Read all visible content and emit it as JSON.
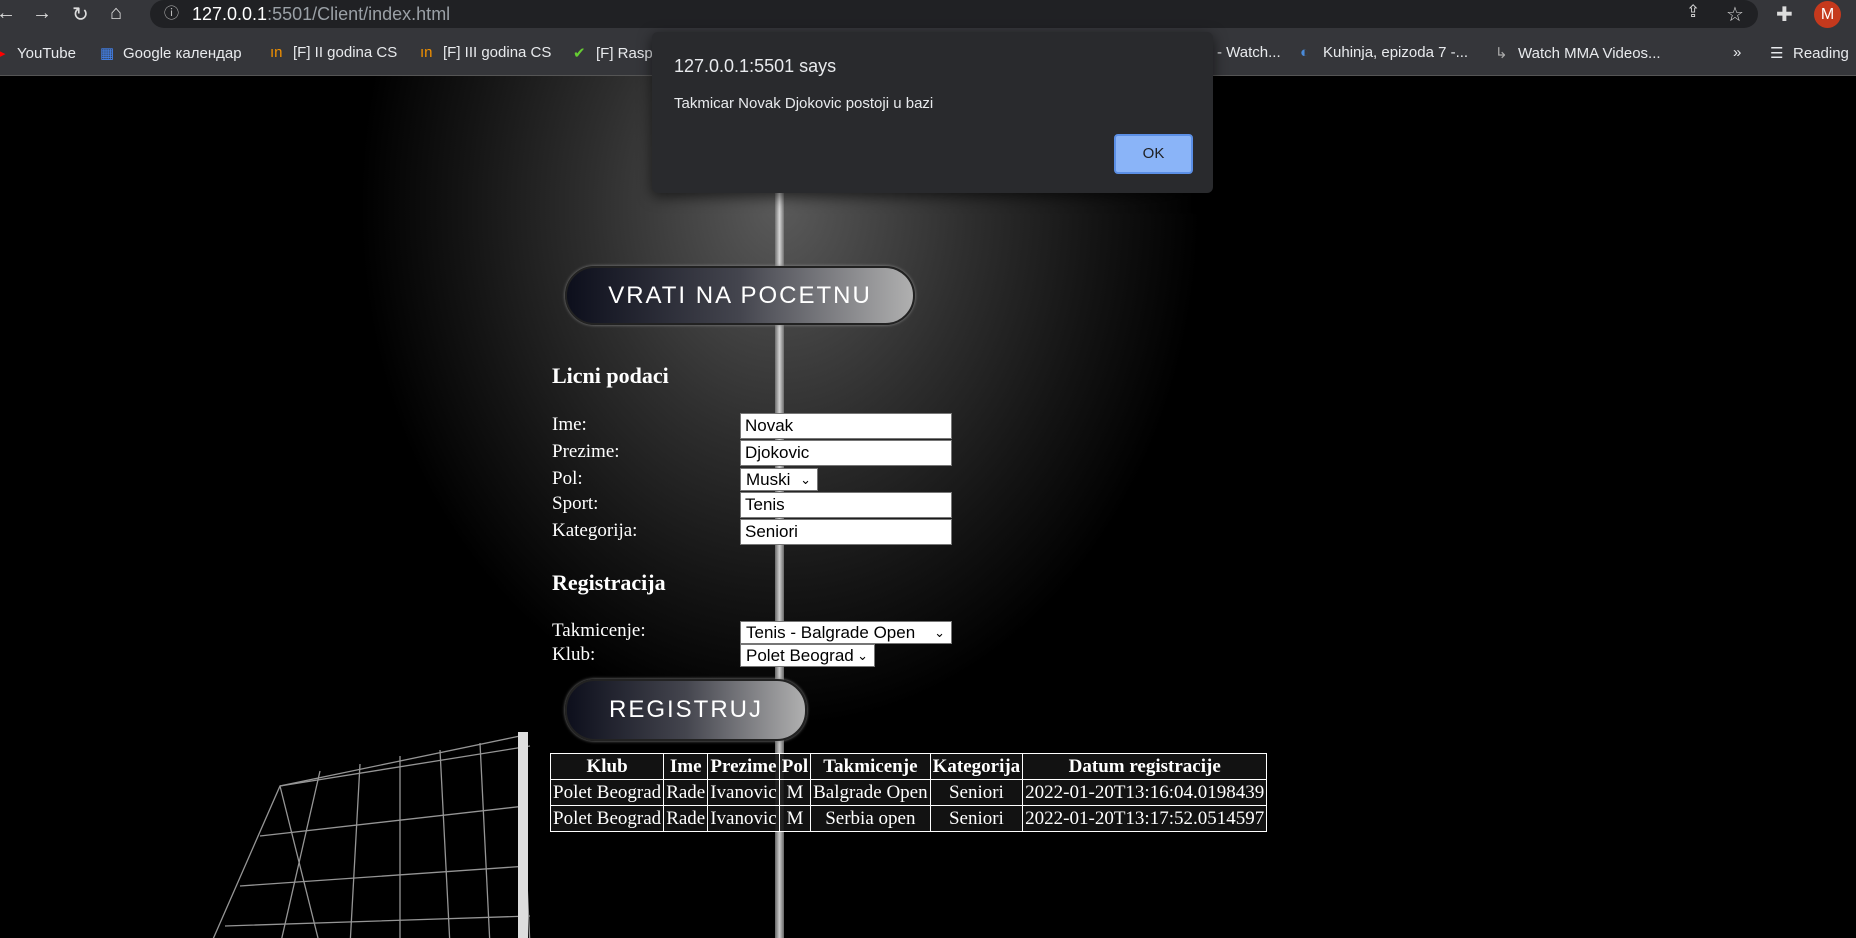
{
  "browser": {
    "url_host": "127.0.0.1",
    "url_rest": ":5501/Client/index.html",
    "avatar_letter": "M",
    "bookmarks": [
      "YouTube",
      "Google календар",
      "[F] II godina CS",
      "[F] III godina CS",
      "[F] Rasp",
      "- Watch...",
      "Kuhinja, epizoda 7 -...",
      "Watch MMA Videos...",
      "»",
      "Reading"
    ]
  },
  "dialog": {
    "title": "127.0.0.1:5501 says",
    "message": "Takmicar Novak Djokovic postoji u bazi",
    "ok_label": "OK"
  },
  "back_button": "VRATI NA POCETNU",
  "personal": {
    "heading": "Licni podaci",
    "ime_label": "Ime:",
    "ime_value": "Novak",
    "prezime_label": "Prezime:",
    "prezime_value": "Djokovic",
    "pol_label": "Pol:",
    "pol_value": "Muski",
    "sport_label": "Sport:",
    "sport_value": "Tenis",
    "kategorija_label": "Kategorija:",
    "kategorija_value": "Seniori"
  },
  "registration": {
    "heading": "Registracija",
    "takmicenje_label": "Takmicenje:",
    "takmicenje_value": "Tenis - Balgrade Open",
    "klub_label": "Klub:",
    "klub_value": "Polet Beograd",
    "submit": "REGISTRUJ"
  },
  "table": {
    "headers": [
      "Klub",
      "Ime",
      "Prezime",
      "Pol",
      "Takmicenje",
      "Kategorija",
      "Datum registracije"
    ],
    "rows": [
      [
        "Polet Beograd",
        "Rade",
        "Ivanovic",
        "M",
        "Balgrade Open",
        "Seniori",
        "2022-01-20T13:16:04.0198439"
      ],
      [
        "Polet Beograd",
        "Rade",
        "Ivanovic",
        "M",
        "Serbia open",
        "Seniori",
        "2022-01-20T13:17:52.0514597"
      ]
    ]
  }
}
